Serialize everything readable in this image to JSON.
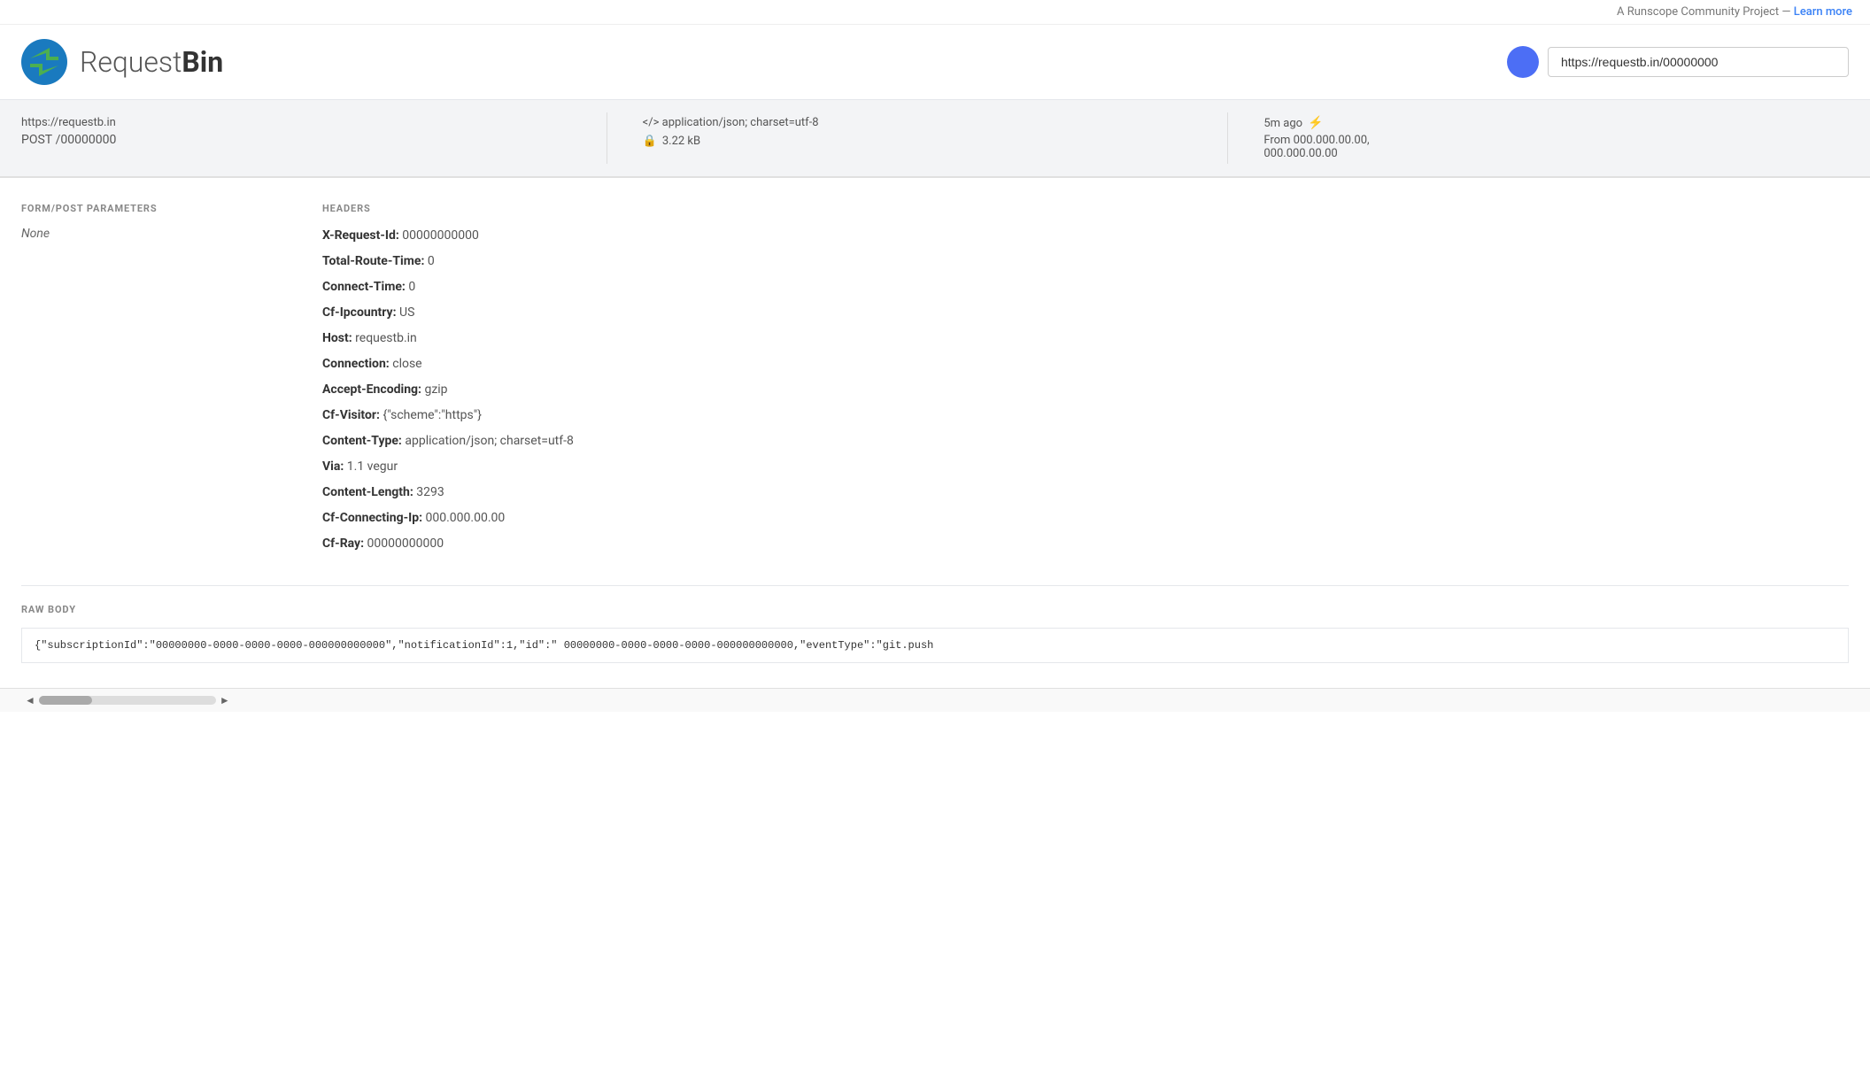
{
  "top_banner": {
    "text": "A Runscope Community Project — ",
    "link_label": "Learn more",
    "link_href": "#"
  },
  "header": {
    "logo_text_normal": "Request",
    "logo_text_bold": "Bin",
    "url_value": "https://requestb.in/00000000"
  },
  "request_info": {
    "url": "https://requestb.in",
    "method": "POST",
    "path": "/00000000",
    "content_type": "</> application/json; charset=utf-8",
    "size": "3.22 kB",
    "time_ago": "5m ago",
    "from_label": "From 000.000.00.00,",
    "from_ip2": "000.000.00.00"
  },
  "form_post": {
    "section_title": "FORM/POST PARAMETERS",
    "value": "None"
  },
  "headers_section": {
    "section_title": "HEADERS",
    "entries": [
      {
        "key": "X-Request-Id:",
        "value": "00000000000"
      },
      {
        "key": "Total-Route-Time:",
        "value": "0"
      },
      {
        "key": "Connect-Time:",
        "value": "0"
      },
      {
        "key": "Cf-Ipcountry:",
        "value": "US"
      },
      {
        "key": "Host:",
        "value": "requestb.in"
      },
      {
        "key": "Connection:",
        "value": "close"
      },
      {
        "key": "Accept-Encoding:",
        "value": "gzip"
      },
      {
        "key": "Cf-Visitor:",
        "value": "{\"scheme\":\"https\"}"
      },
      {
        "key": "Content-Type:",
        "value": "application/json; charset=utf-8"
      },
      {
        "key": "Via:",
        "value": "1.1 vegur"
      },
      {
        "key": "Content-Length:",
        "value": "3293"
      },
      {
        "key": "Cf-Connecting-Ip:",
        "value": "000.000.00.00"
      },
      {
        "key": "Cf-Ray:",
        "value": "00000000000"
      }
    ]
  },
  "raw_body": {
    "section_title": "RAW BODY",
    "content": "{\"subscriptionId\":\"00000000-0000-0000-0000-000000000000\",\"notificationId\":1,\"id\":\" 00000000-0000-0000-0000-000000000000,\"eventType\":\"git.push"
  },
  "icons": {
    "lock": "🔒",
    "link": "⚡",
    "left_arrow": "◄",
    "right_arrow": "►"
  }
}
